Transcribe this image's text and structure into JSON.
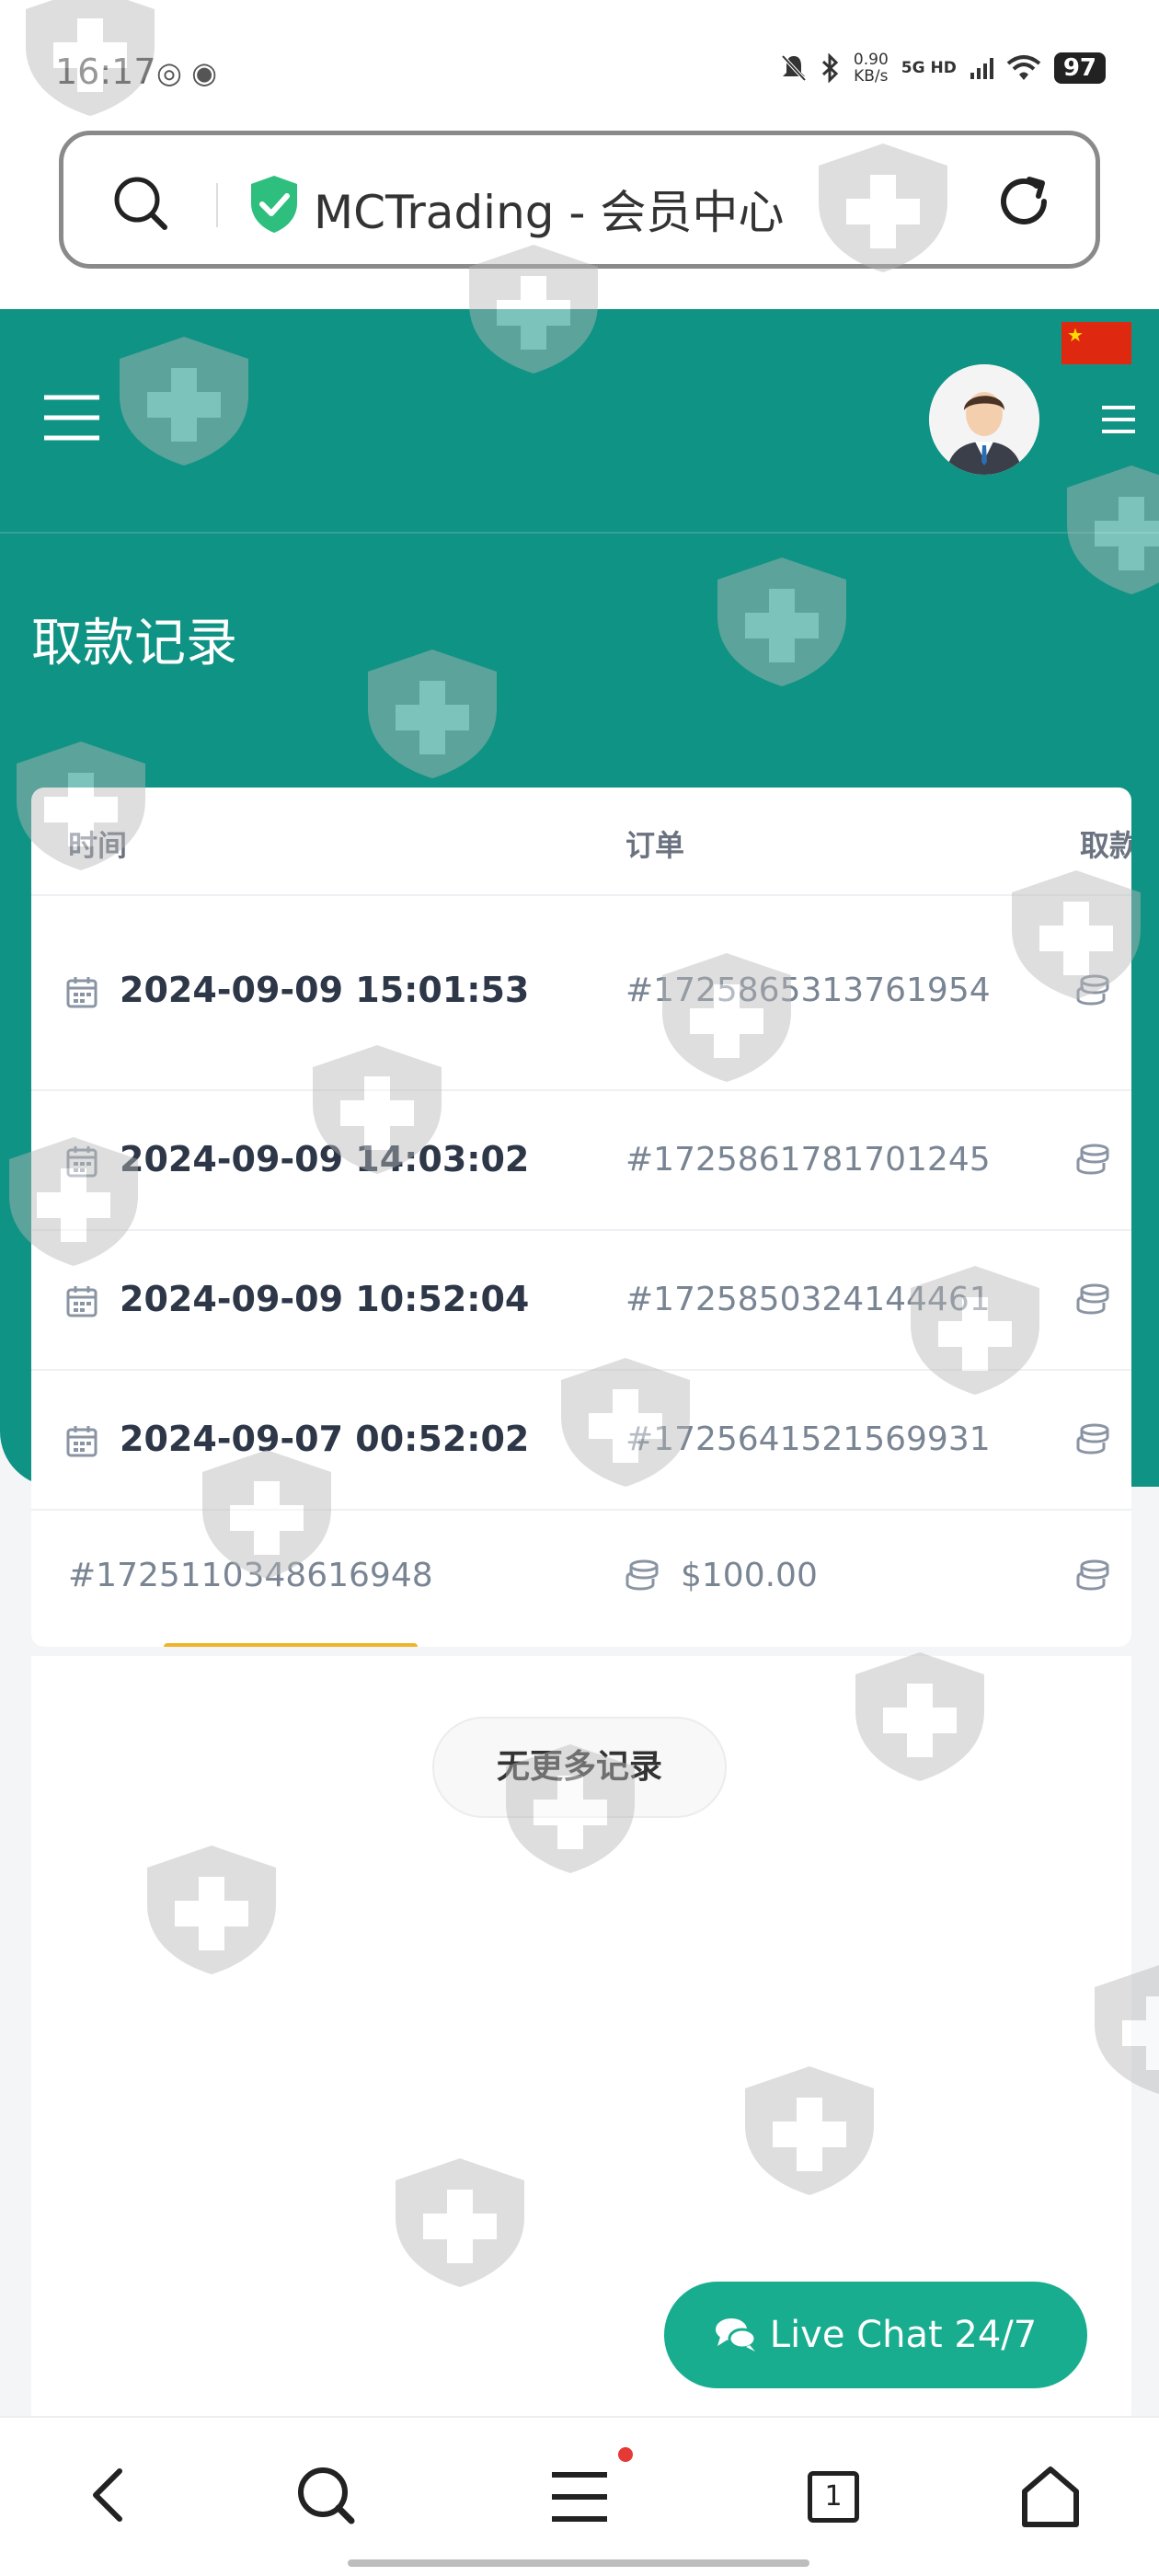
{
  "status_bar": {
    "time": "16:17",
    "net_speed_value": "0.90",
    "net_speed_unit": "KB/s",
    "signal": "5G HD",
    "battery": "97"
  },
  "browser": {
    "address_title": "MCTrading - 会员中心"
  },
  "colors": {
    "header_green": "#0f9384",
    "live_chat": "#19ad8f",
    "scroll_indicator": "#f0b429"
  },
  "header": {
    "page_title": "取款记录"
  },
  "table": {
    "columns": [
      "时间",
      "订单",
      "取款"
    ],
    "rows": [
      {
        "datetime": "2024-09-09 15:01:53",
        "order": "#1725865313761954"
      },
      {
        "datetime": "2024-09-09 14:03:02",
        "order": "#1725861781701245"
      },
      {
        "datetime": "2024-09-09 10:52:04",
        "order": "#1725850324144461"
      },
      {
        "datetime": "2024-09-07 00:52:02",
        "order": "#1725641521569931"
      }
    ],
    "last_row": {
      "order": "#1725110348616948",
      "amount": "$100.00"
    }
  },
  "no_more_records": "无更多记录",
  "live_chat": "Live Chat 24/7",
  "bottom_nav": {
    "tab_count": "1"
  }
}
